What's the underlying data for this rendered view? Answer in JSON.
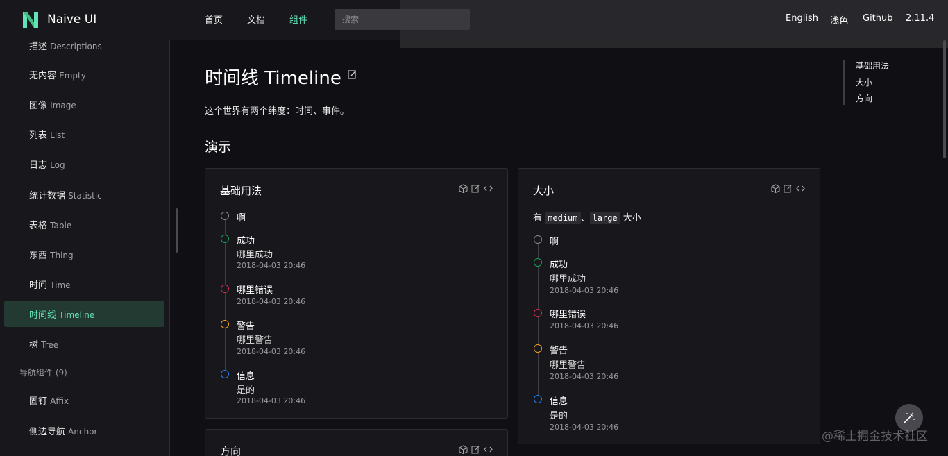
{
  "header": {
    "brand": "Naive UI",
    "nav": [
      {
        "label": "首页"
      },
      {
        "label": "文档"
      },
      {
        "label": "组件"
      }
    ],
    "search_placeholder": "搜索",
    "right": [
      "English",
      "浅色",
      "Github",
      "2.11.4"
    ],
    "accent": "#63e2b7"
  },
  "sidebar": {
    "items": [
      {
        "zh": "描述",
        "en": "Descriptions"
      },
      {
        "zh": "无内容",
        "en": "Empty"
      },
      {
        "zh": "图像",
        "en": "Image"
      },
      {
        "zh": "列表",
        "en": "List"
      },
      {
        "zh": "日志",
        "en": "Log"
      },
      {
        "zh": "统计数据",
        "en": "Statistic"
      },
      {
        "zh": "表格",
        "en": "Table"
      },
      {
        "zh": "东西",
        "en": "Thing"
      },
      {
        "zh": "时间",
        "en": "Time"
      },
      {
        "zh": "时间线",
        "en": "Timeline"
      },
      {
        "zh": "树",
        "en": "Tree"
      }
    ],
    "group": "导航组件 (9)",
    "group_items": [
      {
        "zh": "固钉",
        "en": "Affix"
      },
      {
        "zh": "侧边导航",
        "en": "Anchor"
      }
    ]
  },
  "main": {
    "title": "时间线 Timeline",
    "description": "这个世界有两个纬度：时间、事件。",
    "section": "演示",
    "cards": {
      "basic": {
        "title": "基础用法",
        "items": [
          {
            "title": "啊",
            "content": "",
            "time": "",
            "color": "#888888"
          },
          {
            "title": "成功",
            "content": "哪里成功",
            "time": "2018-04-03 20:46",
            "color": "#18a058"
          },
          {
            "title": "哪里错误",
            "content": "",
            "time": "2018-04-03 20:46",
            "color": "#d03050"
          },
          {
            "title": "警告",
            "content": "哪里警告",
            "time": "2018-04-03 20:46",
            "color": "#f0a020"
          },
          {
            "title": "信息",
            "content": "是的",
            "time": "2018-04-03 20:46",
            "color": "#2080f0"
          }
        ]
      },
      "size": {
        "title": "大小",
        "desc_prefix": "有",
        "code1": "medium",
        "sep": "、",
        "code2": "large",
        "desc_suffix": "大小",
        "items": [
          {
            "title": "啊",
            "content": "",
            "time": "",
            "color": "#888888"
          },
          {
            "title": "成功",
            "content": "哪里成功",
            "time": "2018-04-03 20:46",
            "color": "#18a058"
          },
          {
            "title": "哪里错误",
            "content": "",
            "time": "2018-04-03 20:46",
            "color": "#d03050"
          },
          {
            "title": "警告",
            "content": "哪里警告",
            "time": "2018-04-03 20:46",
            "color": "#f0a020"
          },
          {
            "title": "信息",
            "content": "是的",
            "time": "2018-04-03 20:46",
            "color": "#2080f0"
          }
        ]
      },
      "direction": {
        "title": "方向"
      }
    }
  },
  "toc": [
    "基础用法",
    "大小",
    "方向"
  ],
  "watermark": "@稀土掘金技术社区"
}
